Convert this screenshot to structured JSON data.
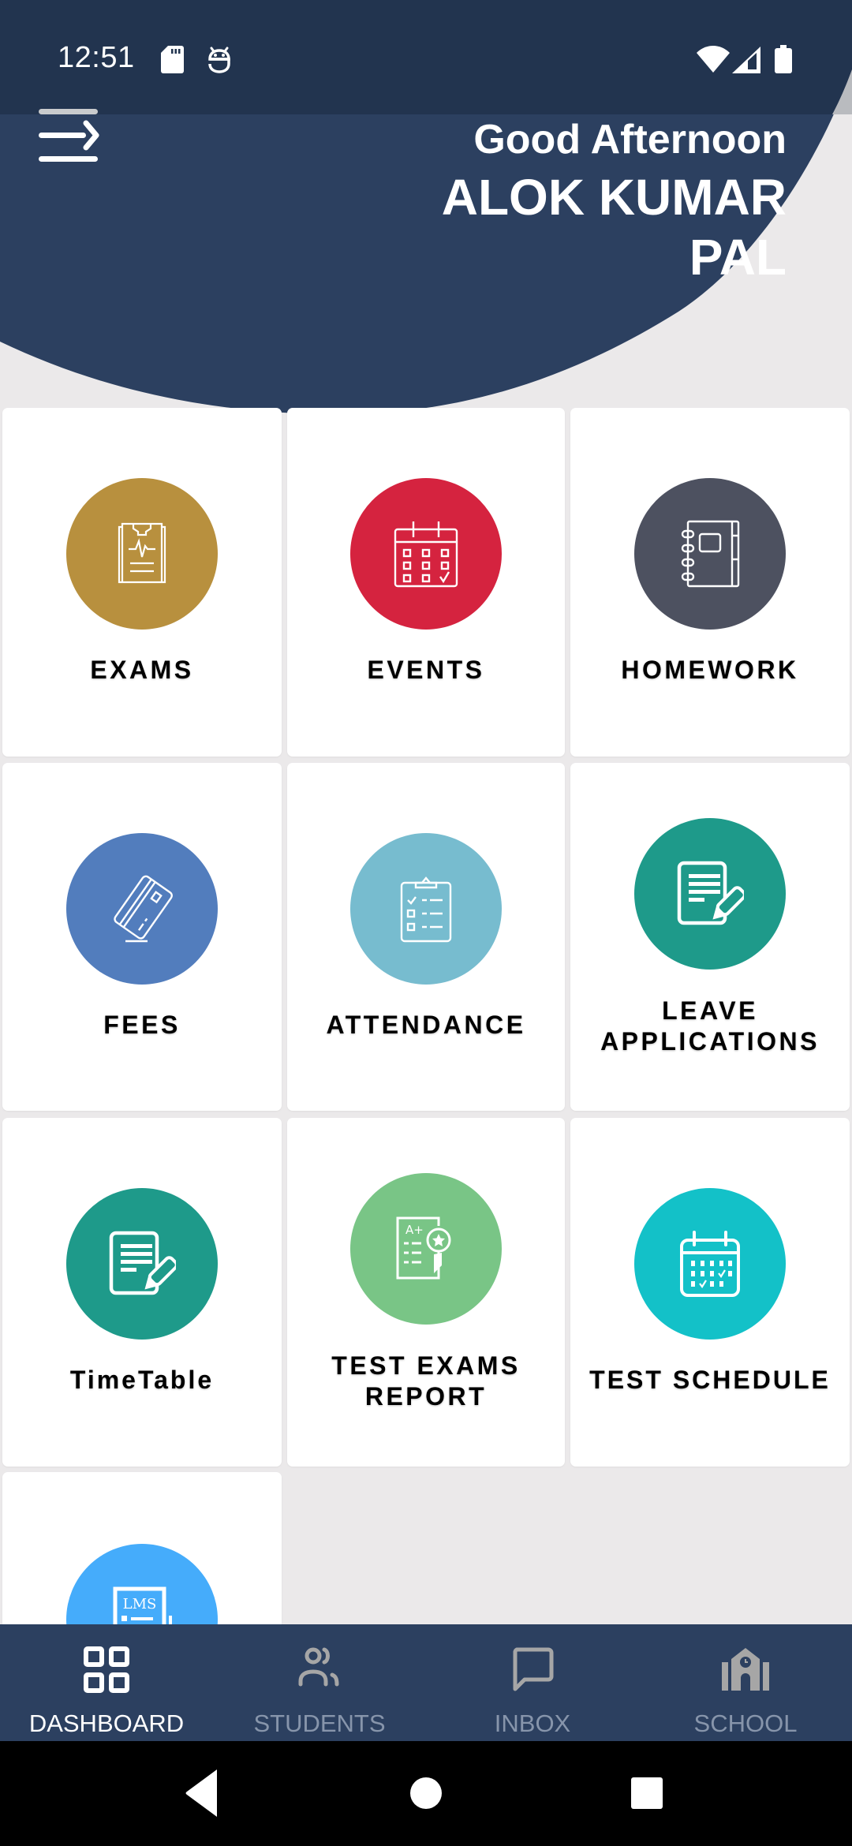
{
  "status_bar": {
    "time": "12:51",
    "left_icons": [
      "sd-card-icon",
      "android-debug-icon"
    ],
    "right_icons": [
      "wifi-icon",
      "cell-signal-icon",
      "battery-icon"
    ]
  },
  "header": {
    "menu_icon": "menu-arrow-icon",
    "greeting": "Good Afternoon",
    "user_name_line1": "ALOK KUMAR",
    "user_name_line2": "PAL",
    "bg_color": "#2c4060"
  },
  "tiles": [
    {
      "id": "exams",
      "label": "EXAMS",
      "icon": "clipboard-pulse-icon",
      "color": "#b8903e"
    },
    {
      "id": "events",
      "label": "EVENTS",
      "icon": "calendar-icon",
      "color": "#d5233f"
    },
    {
      "id": "homework",
      "label": "HOMEWORK",
      "icon": "notebook-icon",
      "color": "#4d5160"
    },
    {
      "id": "fees",
      "label": "FEES",
      "icon": "credit-card-icon",
      "color": "#527dbd"
    },
    {
      "id": "attendance",
      "label": "ATTENDANCE",
      "icon": "checklist-clipboard-icon",
      "color": "#77bccf"
    },
    {
      "id": "leave",
      "label_line1": "LEAVE",
      "label_line2": "APPLICATIONS",
      "icon": "document-pencil-icon",
      "color": "#1e9a8a"
    },
    {
      "id": "timetable",
      "label": "TimeTable",
      "icon": "document-pencil-icon",
      "color": "#1e9a8a"
    },
    {
      "id": "test-exams-report",
      "label_line1": "TEST EXAMS",
      "label_line2": "REPORT",
      "icon": "report-card-icon",
      "color": "#79c586"
    },
    {
      "id": "test-schedule",
      "label": "TEST SCHEDULE",
      "icon": "schedule-calendar-icon",
      "color": "#13c1c8"
    },
    {
      "id": "lms",
      "label": "",
      "icon": "lms-icon",
      "icon_text": "LMS",
      "color": "#45acfb"
    }
  ],
  "bottom_nav": {
    "items": [
      {
        "label": "DASHBOARD",
        "icon": "dashboard-grid-icon",
        "active": true
      },
      {
        "label": "STUDENTS",
        "icon": "people-icon",
        "active": false
      },
      {
        "label": "INBOX",
        "icon": "chat-bubble-icon",
        "active": false
      },
      {
        "label": "SCHOOL",
        "icon": "school-building-icon",
        "active": false
      }
    ]
  },
  "system_nav": [
    "back-icon",
    "home-icon",
    "recents-icon"
  ]
}
